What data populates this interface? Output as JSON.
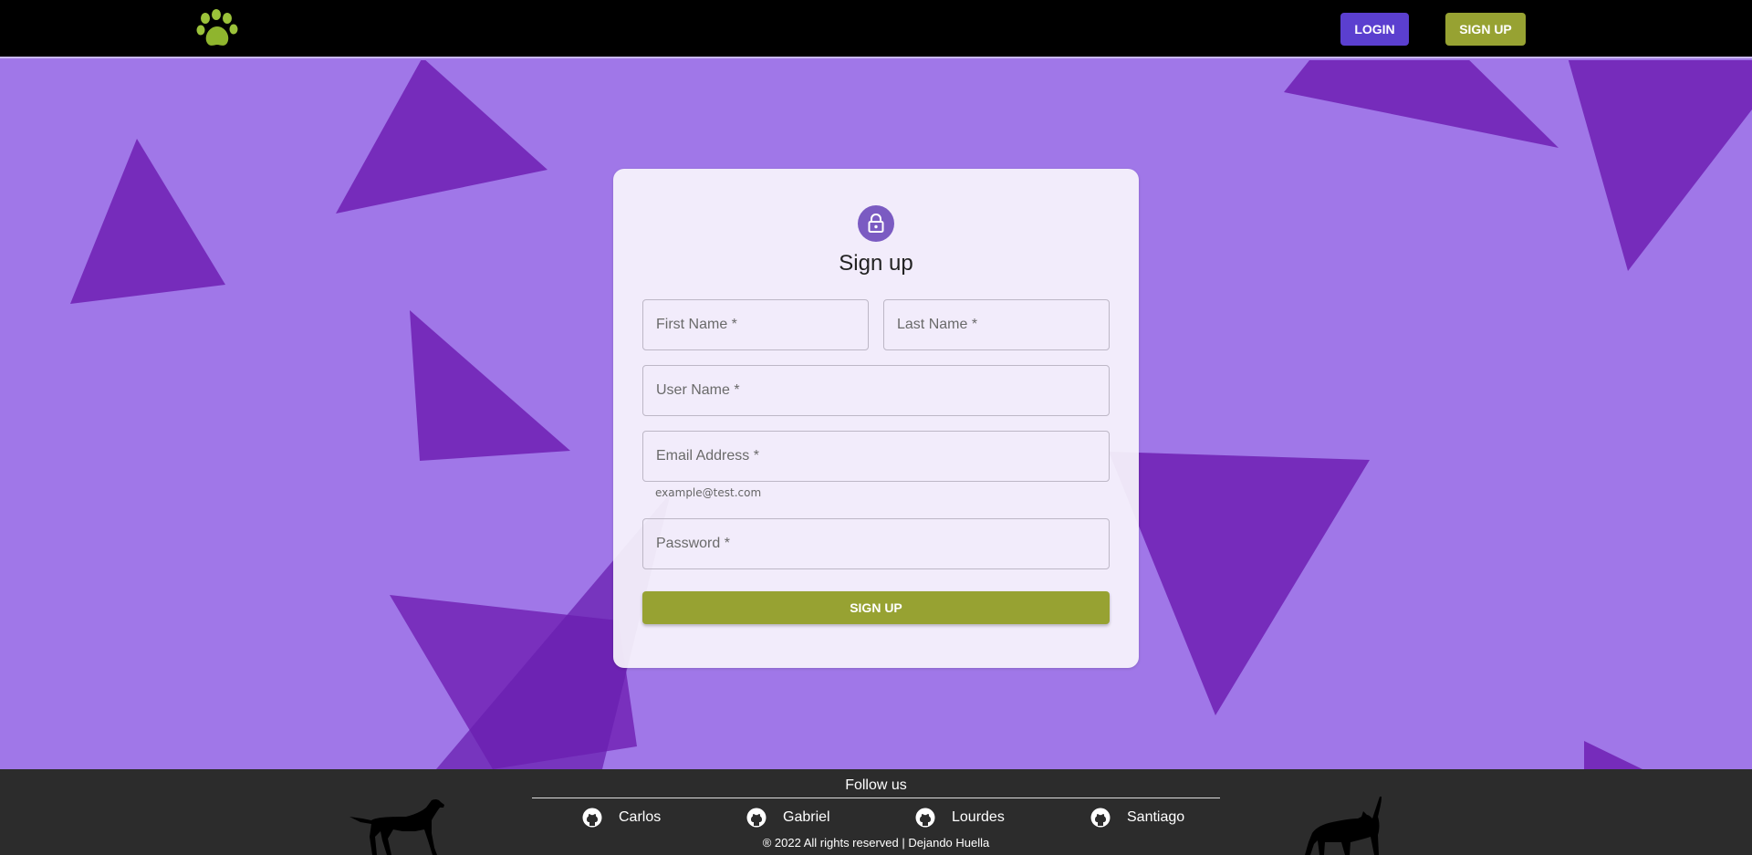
{
  "header": {
    "logo_icon": "paw-icon",
    "login_label": "LOGIN",
    "signup_label": "SIGN UP"
  },
  "form": {
    "icon": "lock-icon",
    "title": "Sign up",
    "first_name_label": "First Name *",
    "last_name_label": "Last Name *",
    "username_label": "User Name *",
    "email_label": "Email Address *",
    "email_helper": "example@test.com",
    "password_label": "Password *",
    "submit_label": "SIGN UP"
  },
  "footer": {
    "follow_label": "Follow us",
    "members": [
      {
        "name": "Carlos",
        "icon": "github-icon"
      },
      {
        "name": "Gabriel",
        "icon": "github-icon"
      },
      {
        "name": "Lourdes",
        "icon": "github-icon"
      },
      {
        "name": "Santiago",
        "icon": "github-icon"
      }
    ],
    "copyright": "® 2022 All rights reserved | Dejando Huella"
  },
  "colors": {
    "background": "#a077e8",
    "triangle": "#7428b8",
    "header_bg": "#000000",
    "login_button": "#5b3fcf",
    "signup_button": "#97a232",
    "footer_bg": "#2c2c2c"
  }
}
